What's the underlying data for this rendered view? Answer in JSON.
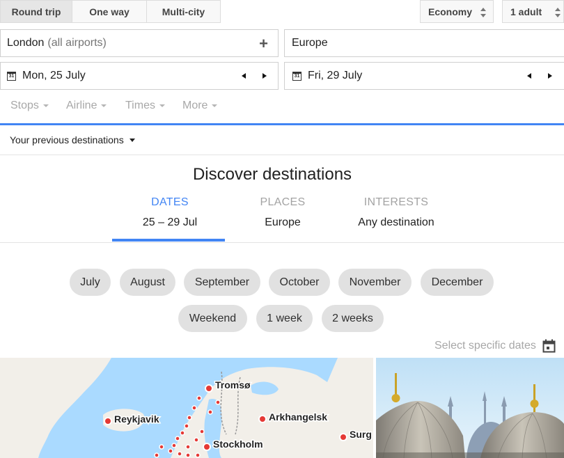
{
  "trip_types": [
    "Round trip",
    "One way",
    "Multi-city"
  ],
  "cabin_class": "Economy",
  "passengers": "1 adult",
  "origin": {
    "city": "London",
    "detail": "(all airports)",
    "add_symbol": "+"
  },
  "destination": "Europe",
  "depart": {
    "icon_text": "31",
    "date": "Mon, 25 July"
  },
  "return": {
    "icon_text": "31",
    "date": "Fri, 29 July"
  },
  "filters": [
    "Stops",
    "Airline",
    "Times",
    "More"
  ],
  "previous_destinations": "Your previous destinations",
  "discover": {
    "title": "Discover destinations",
    "tabs": [
      {
        "heading": "DATES",
        "value": "25 – 29 Jul"
      },
      {
        "heading": "PLACES",
        "value": "Europe"
      },
      {
        "heading": "INTERESTS",
        "value": "Any destination"
      }
    ]
  },
  "months": [
    "July",
    "August",
    "September",
    "October",
    "November",
    "December"
  ],
  "durations": [
    "Weekend",
    "1 week",
    "2 weeks"
  ],
  "select_specific_dates": "Select specific dates",
  "map_cities": [
    "Tromsø",
    "Reykjavik",
    "Arkhangelsk",
    "Stockholm",
    "Surg"
  ],
  "colors": {
    "accent": "#4285f4",
    "chip": "#e1e1e1",
    "marker": "#e53935",
    "water": "#aadaff",
    "land": "#f2efe9"
  }
}
